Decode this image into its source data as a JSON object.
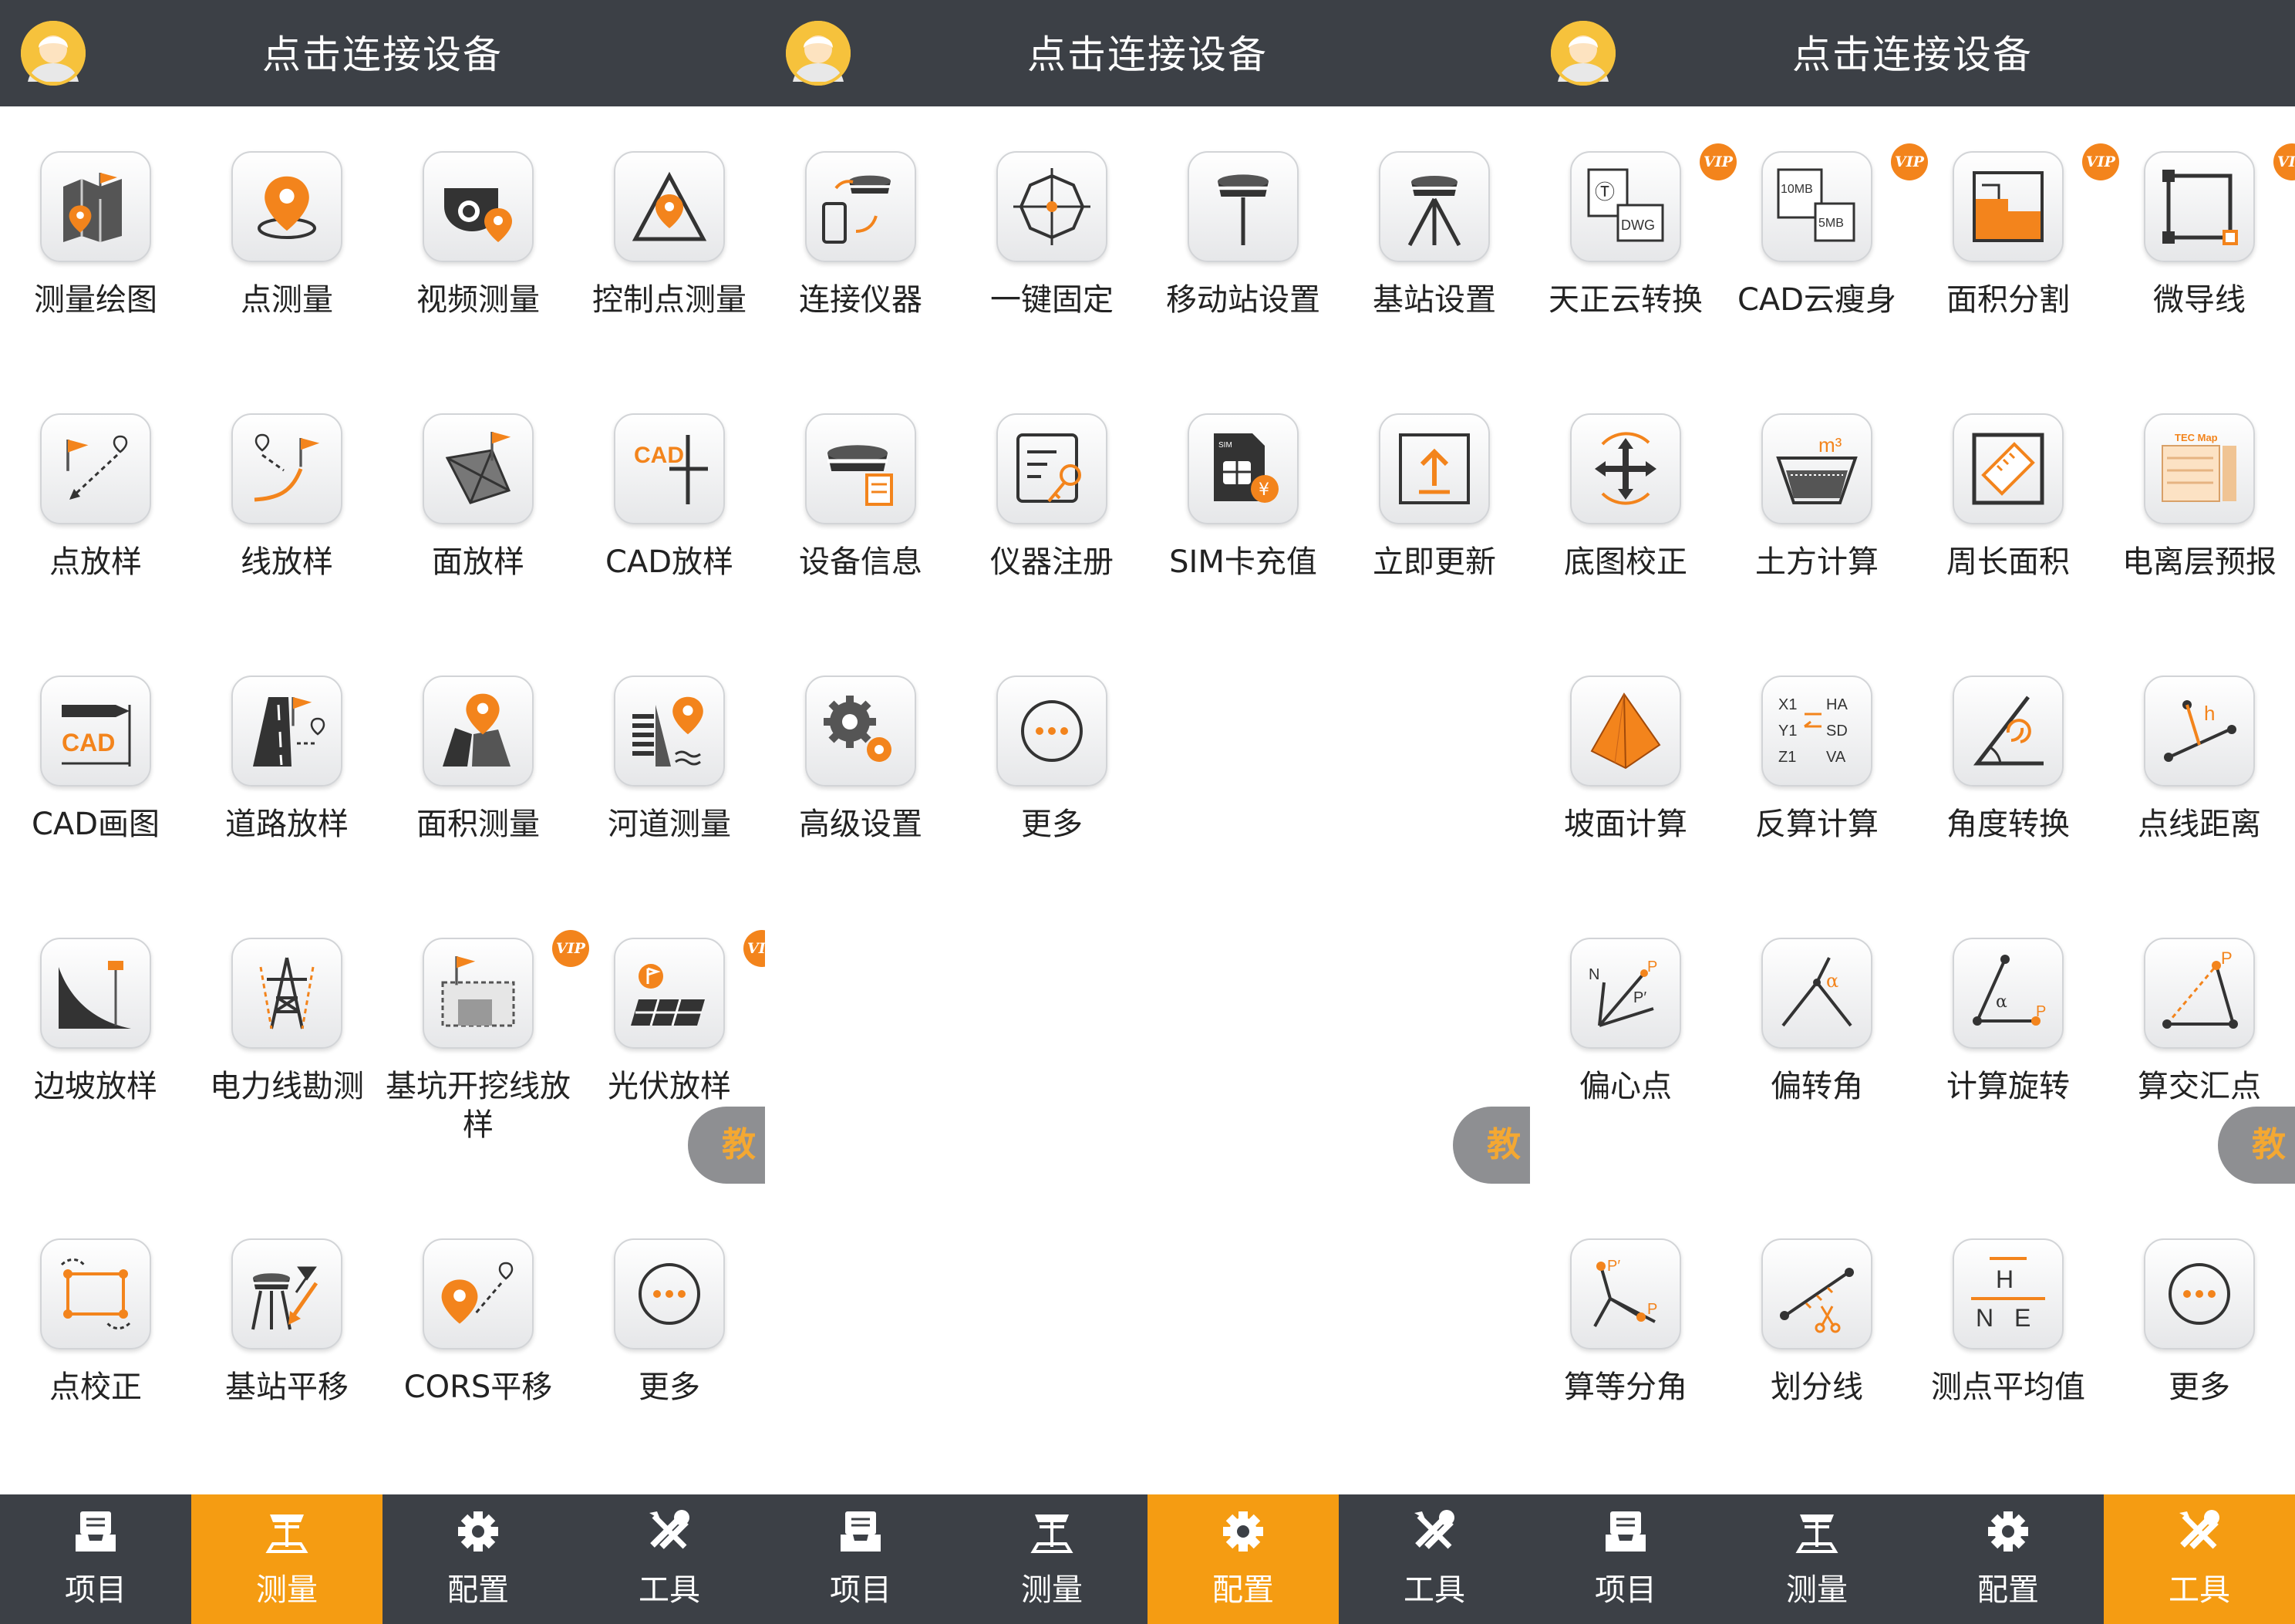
{
  "colors": {
    "header_bg": "#3c4046",
    "accent": "#f59c12",
    "icon_orange": "#f3841c",
    "vip_bg": "#f3841c"
  },
  "panels": [
    {
      "header": {
        "title": "点击连接设备",
        "avatar_icon": "user-avatar-icon"
      },
      "active_tab": "tab-measure",
      "floating_button": "教",
      "tiles": [
        {
          "label": "测量绘图",
          "icon": "map-flag-icon"
        },
        {
          "label": "点测量",
          "icon": "location-pin-icon"
        },
        {
          "label": "视频测量",
          "icon": "camera-pin-icon"
        },
        {
          "label": "控制点测量",
          "icon": "triangle-pin-icon"
        },
        {
          "label": "点放样",
          "icon": "flag-dashed-arrow-icon"
        },
        {
          "label": "线放样",
          "icon": "curve-flag-icon"
        },
        {
          "label": "面放样",
          "icon": "polygon-flag-icon"
        },
        {
          "label": "CAD放样",
          "icon": "cad-crosshair-icon"
        },
        {
          "label": "CAD画图",
          "icon": "cad-ruler-icon"
        },
        {
          "label": "道路放样",
          "icon": "road-flag-icon"
        },
        {
          "label": "面积测量",
          "icon": "area-pin-icon"
        },
        {
          "label": "河道测量",
          "icon": "river-pin-icon"
        },
        {
          "label": "边坡放样",
          "icon": "slope-pole-icon"
        },
        {
          "label": "电力线勘测",
          "icon": "power-tower-icon"
        },
        {
          "label": "基坑开挖线放样",
          "icon": "excavation-flag-icon",
          "vip": "VIP"
        },
        {
          "label": "光伏放样",
          "icon": "solar-panel-icon",
          "vip": "VIP"
        },
        {
          "label": "点校正",
          "icon": "point-correction-icon"
        },
        {
          "label": "基站平移",
          "icon": "base-station-shift-icon"
        },
        {
          "label": "CORS平移",
          "icon": "cors-shift-icon"
        },
        {
          "label": "更多",
          "icon": "more-dots-icon"
        }
      ]
    },
    {
      "header": {
        "title": "点击连接设备",
        "avatar_icon": "user-avatar-icon"
      },
      "active_tab": "tab-config",
      "floating_button": "教",
      "tiles": [
        {
          "label": "连接仪器",
          "icon": "connect-device-icon"
        },
        {
          "label": "一键固定",
          "icon": "crosshair-target-icon"
        },
        {
          "label": "移动站设置",
          "icon": "rover-receiver-icon"
        },
        {
          "label": "基站设置",
          "icon": "base-tripod-icon"
        },
        {
          "label": "设备信息",
          "icon": "device-info-icon"
        },
        {
          "label": "仪器注册",
          "icon": "register-key-icon"
        },
        {
          "label": "SIM卡充值",
          "icon": "sim-card-icon"
        },
        {
          "label": "立即更新",
          "icon": "update-upload-icon"
        },
        {
          "label": "高级设置",
          "icon": "gears-icon"
        },
        {
          "label": "更多",
          "icon": "more-dots-icon"
        }
      ]
    },
    {
      "header": {
        "title": "点击连接设备",
        "avatar_icon": "user-avatar-icon"
      },
      "active_tab": "tab-tools",
      "floating_button": "教",
      "tiles": [
        {
          "label": "天正云转换",
          "icon": "dwg-convert-icon",
          "vip": "VIP",
          "sub": "DWG"
        },
        {
          "label": "CAD云瘦身",
          "icon": "cad-slim-icon",
          "vip": "VIP",
          "sub_a": "10MB",
          "sub_b": "5MB"
        },
        {
          "label": "面积分割",
          "icon": "area-split-icon",
          "vip": "VIP"
        },
        {
          "label": "微导线",
          "icon": "micro-traverse-icon",
          "vip": "VIP"
        },
        {
          "label": "底图校正",
          "icon": "map-correction-icon"
        },
        {
          "label": "土方计算",
          "icon": "earthwork-icon",
          "sub": "m³"
        },
        {
          "label": "周长面积",
          "icon": "perimeter-ruler-icon"
        },
        {
          "label": "电离层预报",
          "icon": "tec-map-icon",
          "sub": "TEC Map"
        },
        {
          "label": "坡面计算",
          "icon": "pyramid-icon"
        },
        {
          "label": "反算计算",
          "icon": "inverse-calc-icon",
          "sub_a": "X1",
          "sub_b": "Y1",
          "sub_c": "Z1",
          "sub_d": "HA",
          "sub_e": "SD",
          "sub_f": "VA"
        },
        {
          "label": "角度转换",
          "icon": "angle-convert-icon"
        },
        {
          "label": "点线距离",
          "icon": "point-line-distance-icon",
          "sub": "h"
        },
        {
          "label": "偏心点",
          "icon": "eccentric-point-icon",
          "sub_a": "N",
          "sub_b": "P",
          "sub_c": "P′"
        },
        {
          "label": "偏转角",
          "icon": "deflection-angle-icon",
          "sub": "α"
        },
        {
          "label": "计算旋转",
          "icon": "rotation-calc-icon",
          "sub_a": "α",
          "sub_b": "P"
        },
        {
          "label": "算交汇点",
          "icon": "intersection-icon",
          "sub": "P"
        },
        {
          "label": "算等分角",
          "icon": "bisect-angle-icon",
          "sub_a": "P′",
          "sub_b": "P"
        },
        {
          "label": "划分线",
          "icon": "divide-line-icon"
        },
        {
          "label": "测点平均值",
          "icon": "point-average-icon",
          "sub_a": "H",
          "sub_b": "N",
          "sub_c": "E"
        },
        {
          "label": "更多",
          "icon": "more-dots-icon"
        }
      ]
    }
  ],
  "tabs": [
    {
      "label": "项目",
      "icon": "project-inbox-icon",
      "name": "tab-project"
    },
    {
      "label": "测量",
      "icon": "survey-receiver-icon",
      "name": "tab-measure"
    },
    {
      "label": "配置",
      "icon": "settings-gear-icon",
      "name": "tab-config"
    },
    {
      "label": "工具",
      "icon": "tools-wrench-icon",
      "name": "tab-tools"
    }
  ]
}
